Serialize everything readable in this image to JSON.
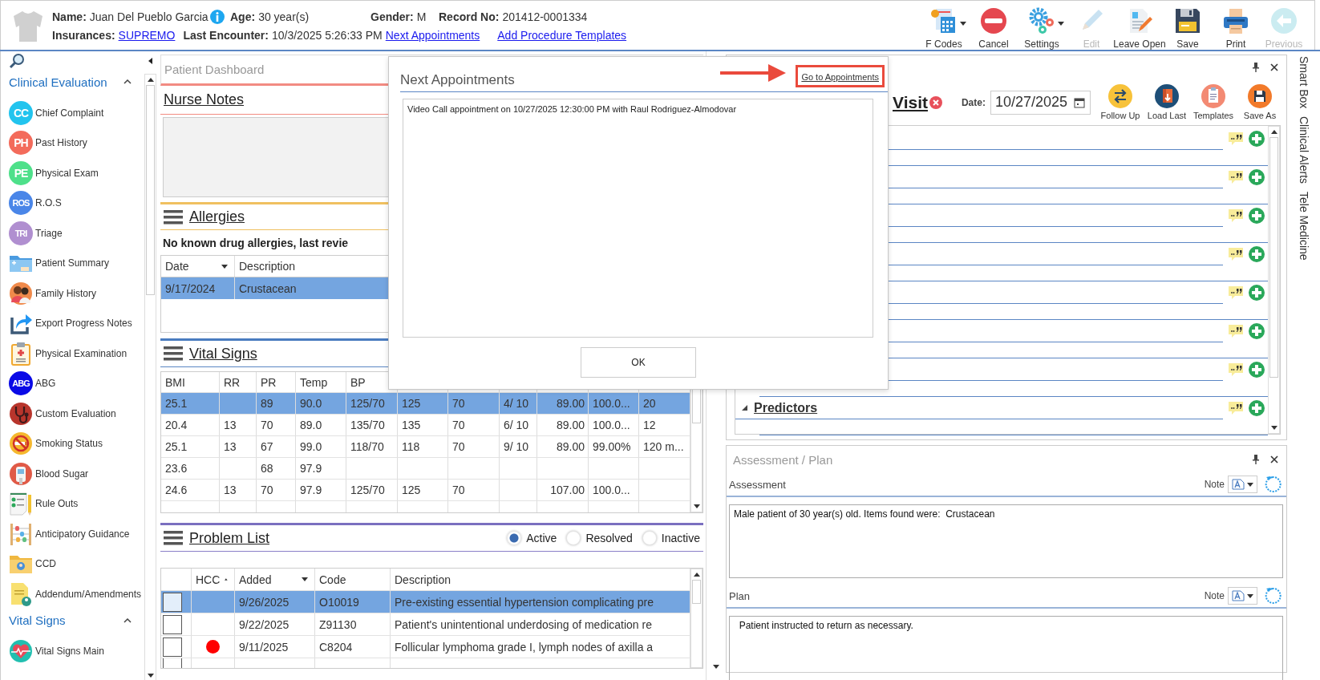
{
  "patient": {
    "name_label": "Name:",
    "name": "Juan Del Pueblo Garcia",
    "age_label": "Age:",
    "age": "30 year(s)",
    "gender_label": "Gender:",
    "gender": "M",
    "record_label": "Record No:",
    "record": "201412-0001334",
    "insurances_label": "Insurances:",
    "insurance": "SUPREMO",
    "encounter_label": "Last Encounter:",
    "encounter": "10/3/2025 5:26:33 PM",
    "links": [
      "Next Appointments",
      "Add Procedure Templates"
    ]
  },
  "toolbar": [
    {
      "label": "F Codes",
      "dropdown": true,
      "disabled": false
    },
    {
      "label": "Cancel",
      "dropdown": false,
      "disabled": false
    },
    {
      "label": "Settings",
      "dropdown": true,
      "disabled": false
    },
    {
      "label": "Edit",
      "dropdown": false,
      "disabled": true
    },
    {
      "label": "Leave Open",
      "dropdown": false,
      "disabled": false
    },
    {
      "label": "Save",
      "dropdown": false,
      "disabled": false
    },
    {
      "label": "Print",
      "dropdown": false,
      "disabled": false
    },
    {
      "label": "Previous",
      "dropdown": false,
      "disabled": true
    }
  ],
  "sidebar": {
    "groups": [
      {
        "title": "Clinical Evaluation",
        "expanded": true,
        "items": [
          {
            "label": "Chief Complaint",
            "kind": "badge",
            "badge": "CC",
            "color": "#22c4ee"
          },
          {
            "label": "Past History",
            "kind": "badge",
            "badge": "PH",
            "color": "#f36b5b"
          },
          {
            "label": "Physical Exam",
            "kind": "badge",
            "badge": "PE",
            "color": "#4ee08a"
          },
          {
            "label": "R.O.S",
            "kind": "badge",
            "badge": "ROS",
            "color": "#4a86e8"
          },
          {
            "label": "Triage",
            "kind": "badge",
            "badge": "TRI",
            "color": "#b08fd0"
          },
          {
            "label": "Patient Summary",
            "kind": "icon"
          },
          {
            "label": "Family History",
            "kind": "icon"
          },
          {
            "label": "Export Progress Notes",
            "kind": "icon"
          },
          {
            "label": "Physical Examination",
            "kind": "icon"
          },
          {
            "label": "ABG",
            "kind": "badge",
            "badge": "ABG",
            "color": "#0a0ae6"
          },
          {
            "label": "Custom Evaluation",
            "kind": "icon"
          },
          {
            "label": "Smoking Status",
            "kind": "icon"
          },
          {
            "label": "Blood Sugar",
            "kind": "icon"
          },
          {
            "label": "Rule Outs",
            "kind": "icon"
          },
          {
            "label": "Anticipatory Guidance",
            "kind": "icon"
          },
          {
            "label": "CCD",
            "kind": "icon"
          },
          {
            "label": "Addendum/Amendments",
            "kind": "icon"
          }
        ]
      },
      {
        "title": "Vital Signs",
        "expanded": true,
        "items": [
          {
            "label": "Vital Signs Main",
            "kind": "icon"
          }
        ]
      }
    ]
  },
  "dashboard": {
    "title": "Patient Dashboard",
    "nurse_notes": {
      "title": "Nurse Notes"
    },
    "allergies": {
      "title": "Allergies",
      "summary": "No known drug allergies, last revie",
      "columns": [
        "Date",
        "Description"
      ],
      "rows": [
        {
          "cells": [
            "9/17/2024",
            "Crustacean"
          ],
          "selected": true
        }
      ]
    },
    "vital_signs": {
      "title": "Vital Signs",
      "columns": [
        "BMI",
        "RR",
        "PR",
        "Temp",
        "BP"
      ],
      "rows": [
        {
          "cells": [
            "25.1",
            null,
            "89",
            "90.0",
            "125/70",
            "125",
            "70",
            "4/ 10",
            "89.00",
            "100.0...",
            "20"
          ],
          "selected": true
        },
        {
          "cells": [
            "20.4",
            "13",
            "70",
            "89.0",
            "135/70",
            "135",
            "70",
            "6/ 10",
            "89.00",
            "100.0...",
            "12"
          ],
          "selected": false
        },
        {
          "cells": [
            "25.1",
            "13",
            "67",
            "99.0",
            "118/70",
            "118",
            "70",
            "9/ 10",
            "89.00",
            "99.00%",
            "120 m..."
          ],
          "selected": false
        },
        {
          "cells": [
            "23.6",
            null,
            "68",
            "97.9",
            null,
            null,
            null,
            null,
            null,
            null,
            null
          ],
          "selected": false
        },
        {
          "cells": [
            "24.6",
            "13",
            "70",
            "97.9",
            "125/70",
            "125",
            "70",
            null,
            "107.00",
            "100.0...",
            null
          ],
          "selected": false
        }
      ]
    },
    "problem_list": {
      "title": "Problem List",
      "filters": [
        {
          "label": "Active",
          "selected": true
        },
        {
          "label": "Resolved",
          "selected": false
        },
        {
          "label": "Inactive",
          "selected": false
        }
      ],
      "columns": [
        "HCC",
        "Added",
        "Code",
        "Description"
      ],
      "rows": [
        {
          "checked": false,
          "selected": true,
          "hcc": false,
          "added": "9/26/2025",
          "code": "O10019",
          "description": "Pre-existing essential hypertension complicating pre"
        },
        {
          "checked": false,
          "selected": false,
          "hcc": false,
          "added": "9/22/2025",
          "code": "Z91130",
          "description": "Patient's unintentional underdosing of medication re"
        },
        {
          "checked": false,
          "selected": false,
          "hcc": true,
          "added": "9/11/2025",
          "code": "C8204",
          "description": "Follicular lymphoma grade I, lymph nodes of axilla a"
        }
      ]
    }
  },
  "visit": {
    "title": "Visit",
    "date_label": "Date:",
    "date": "10/27/2025",
    "actions": [
      "Follow Up",
      "Load Last",
      "Templates",
      "Save As"
    ],
    "rows": [
      {
        "kind": "covered"
      },
      {
        "kind": "covered"
      },
      {
        "kind": "covered"
      },
      {
        "kind": "covered"
      },
      {
        "kind": "covered"
      },
      {
        "kind": "covered"
      },
      {
        "kind": "covered"
      },
      {
        "kind": "section",
        "label": "Predictors",
        "expanded": true
      }
    ]
  },
  "assessment_plan": {
    "title": "Assessment / Plan",
    "fields": [
      {
        "label": "Assessment",
        "note_label": "Note",
        "text": "Male patient of 30 year(s) old. Items found were:  Crustacean"
      },
      {
        "label": "Plan",
        "note_label": "Note",
        "text": "  Patient instructed to return as necessary."
      }
    ]
  },
  "side_tabs": [
    "Smart Box",
    "Clinical Alerts",
    "Tele Medicine"
  ],
  "popup": {
    "title": "Next Appointments",
    "link": "Go to Appointments",
    "items": [
      "Video Call appointment on 10/27/2025 12:30:00 PM with Raul Rodriguez-Almodovar"
    ],
    "ok": "OK"
  }
}
